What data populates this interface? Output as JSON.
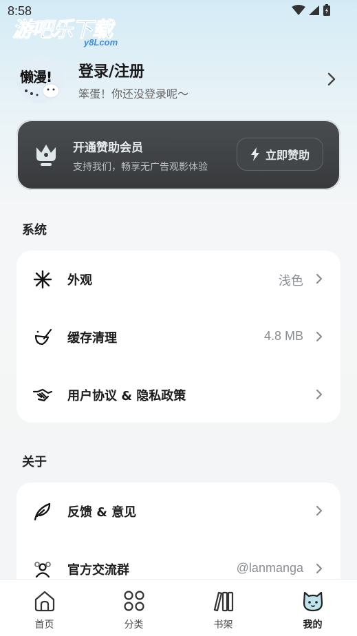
{
  "status_bar": {
    "time": "8:58"
  },
  "watermark": {
    "main": "游吧乐下载",
    "sub": "y8Lcom"
  },
  "profile": {
    "avatar_text": "懒漫!",
    "title": "登录/注册",
    "subtitle": "笨蛋！你还没登录呢～"
  },
  "vip": {
    "title": "开通赞助会员",
    "subtitle": "支持我们，畅享无广告观影体验",
    "button_label": "立即赞助"
  },
  "sections": {
    "system": {
      "title": "系统",
      "items": [
        {
          "label": "外观",
          "value": "浅色",
          "icon": "sparkle-icon"
        },
        {
          "label": "缓存清理",
          "value": "4.8 MB",
          "icon": "broom-icon"
        },
        {
          "label": "用户协议 & 隐私政策",
          "value": "",
          "icon": "handshake-icon"
        }
      ]
    },
    "about": {
      "title": "关于",
      "items": [
        {
          "label": "反馈 & 意见",
          "value": "",
          "icon": "feather-icon"
        },
        {
          "label": "官方交流群",
          "value": "@lanmanga",
          "icon": "group-icon"
        }
      ]
    }
  },
  "tabbar": {
    "tabs": [
      {
        "label": "首页",
        "icon": "home-icon"
      },
      {
        "label": "分类",
        "icon": "grid-icon"
      },
      {
        "label": "书架",
        "icon": "bookshelf-icon"
      },
      {
        "label": "我的",
        "icon": "cat-icon",
        "active": true
      }
    ]
  },
  "colors": {
    "accent": "#3f8fe0",
    "vip_bg": "#3f4244",
    "card_bg": "#ffffff"
  }
}
